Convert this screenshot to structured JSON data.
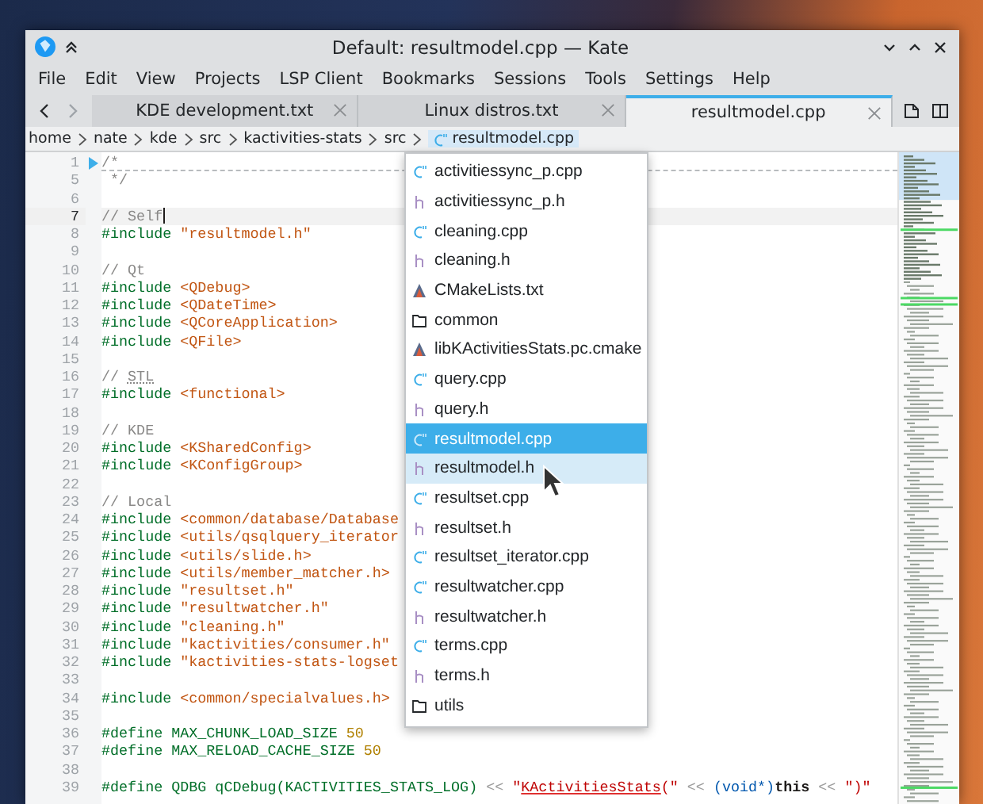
{
  "window": {
    "title": "Default: resultmodel.cpp — Kate"
  },
  "menu": [
    "File",
    "Edit",
    "View",
    "Projects",
    "LSP Client",
    "Bookmarks",
    "Sessions",
    "Tools",
    "Settings",
    "Help"
  ],
  "tabs": [
    {
      "label": "KDE development.txt",
      "selected": false
    },
    {
      "label": "Linux distros.txt",
      "selected": false
    },
    {
      "label": "resultmodel.cpp",
      "selected": true
    }
  ],
  "breadcrumb": {
    "path": [
      "home",
      "nate",
      "kde",
      "src",
      "kactivities-stats",
      "src"
    ],
    "file": "resultmodel.cpp"
  },
  "editor": {
    "lines": [
      {
        "number": "1",
        "current": false,
        "folded": true,
        "code": [
          {
            "kind": "comment",
            "text": "/*"
          }
        ]
      },
      {
        "number": "5",
        "current": false,
        "folded": false,
        "code": [
          {
            "kind": "comment",
            "text": " */"
          }
        ]
      },
      {
        "number": "6",
        "current": false,
        "folded": false
      },
      {
        "number": "7",
        "current": true,
        "folded": false,
        "code": [
          {
            "kind": "comment",
            "text": "// Self"
          }
        ]
      },
      {
        "number": "8",
        "current": false,
        "folded": false,
        "code": [
          {
            "kind": "directive",
            "text": "#include "
          },
          {
            "kind": "header",
            "text": "\"resultmodel.h\""
          }
        ]
      },
      {
        "number": "9",
        "current": false,
        "folded": false
      },
      {
        "number": "10",
        "current": false,
        "folded": false,
        "code": [
          {
            "kind": "comment",
            "text": "// Qt"
          }
        ]
      },
      {
        "number": "11",
        "current": false,
        "folded": false,
        "code": [
          {
            "kind": "directive",
            "text": "#include "
          },
          {
            "kind": "header",
            "text": "<QDebug>"
          }
        ]
      },
      {
        "number": "12",
        "current": false,
        "folded": false,
        "code": [
          {
            "kind": "directive",
            "text": "#include "
          },
          {
            "kind": "header",
            "text": "<QDateTime>"
          }
        ]
      },
      {
        "number": "13",
        "current": false,
        "folded": false,
        "code": [
          {
            "kind": "directive",
            "text": "#include "
          },
          {
            "kind": "header",
            "text": "<QCoreApplication>"
          }
        ]
      },
      {
        "number": "14",
        "current": false,
        "folded": false,
        "code": [
          {
            "kind": "directive",
            "text": "#include "
          },
          {
            "kind": "header",
            "text": "<QFile>"
          }
        ]
      },
      {
        "number": "15",
        "current": false,
        "folded": false
      },
      {
        "number": "16",
        "current": false,
        "folded": false,
        "code": [
          {
            "kind": "comment",
            "text": "// "
          },
          {
            "kind": "flagged_comment",
            "text": "STL"
          }
        ]
      },
      {
        "number": "17",
        "current": false,
        "folded": false,
        "code": [
          {
            "kind": "directive",
            "text": "#include "
          },
          {
            "kind": "header",
            "text": "<functional>"
          }
        ]
      },
      {
        "number": "18",
        "current": false,
        "folded": false
      },
      {
        "number": "19",
        "current": false,
        "folded": false,
        "code": [
          {
            "kind": "comment",
            "text": "// KDE"
          }
        ]
      },
      {
        "number": "20",
        "current": false,
        "folded": false,
        "code": [
          {
            "kind": "directive",
            "text": "#include "
          },
          {
            "kind": "header",
            "text": "<KSharedConfig>"
          }
        ]
      },
      {
        "number": "21",
        "current": false,
        "folded": false,
        "code": [
          {
            "kind": "directive",
            "text": "#include "
          },
          {
            "kind": "header",
            "text": "<KConfigGroup>"
          }
        ]
      },
      {
        "number": "22",
        "current": false,
        "folded": false
      },
      {
        "number": "23",
        "current": false,
        "folded": false,
        "code": [
          {
            "kind": "comment",
            "text": "// Local"
          }
        ]
      },
      {
        "number": "24",
        "current": false,
        "folded": false,
        "code": [
          {
            "kind": "directive",
            "text": "#include "
          },
          {
            "kind": "header",
            "text": "<common/database/Database"
          }
        ]
      },
      {
        "number": "25",
        "current": false,
        "folded": false,
        "code": [
          {
            "kind": "directive",
            "text": "#include "
          },
          {
            "kind": "header",
            "text": "<utils/qsqlquery_iterator"
          }
        ]
      },
      {
        "number": "26",
        "current": false,
        "folded": false,
        "code": [
          {
            "kind": "directive",
            "text": "#include "
          },
          {
            "kind": "header",
            "text": "<utils/slide.h>"
          }
        ]
      },
      {
        "number": "27",
        "current": false,
        "folded": false,
        "code": [
          {
            "kind": "directive",
            "text": "#include "
          },
          {
            "kind": "header",
            "text": "<utils/member_matcher.h>"
          }
        ]
      },
      {
        "number": "28",
        "current": false,
        "folded": false,
        "code": [
          {
            "kind": "directive",
            "text": "#include "
          },
          {
            "kind": "header",
            "text": "\"resultset.h\""
          }
        ]
      },
      {
        "number": "29",
        "current": false,
        "folded": false,
        "code": [
          {
            "kind": "directive",
            "text": "#include "
          },
          {
            "kind": "header",
            "text": "\"resultwatcher.h\""
          }
        ]
      },
      {
        "number": "30",
        "current": false,
        "folded": false,
        "code": [
          {
            "kind": "directive",
            "text": "#include "
          },
          {
            "kind": "header",
            "text": "\"cleaning.h\""
          }
        ]
      },
      {
        "number": "31",
        "current": false,
        "folded": false,
        "code": [
          {
            "kind": "directive",
            "text": "#include "
          },
          {
            "kind": "header",
            "text": "\"kactivities/consumer.h\""
          }
        ]
      },
      {
        "number": "32",
        "current": false,
        "folded": false,
        "code": [
          {
            "kind": "directive",
            "text": "#include "
          },
          {
            "kind": "header",
            "text": "\"kactivities-stats-logset"
          }
        ]
      },
      {
        "number": "33",
        "current": false,
        "folded": false
      },
      {
        "number": "34",
        "current": false,
        "folded": false,
        "code": [
          {
            "kind": "directive",
            "text": "#include "
          },
          {
            "kind": "header",
            "text": "<common/specialvalues.h>"
          }
        ]
      },
      {
        "number": "35",
        "current": false,
        "folded": false
      },
      {
        "number": "36",
        "current": false,
        "folded": false,
        "code": [
          {
            "kind": "directive",
            "text": "#define MAX_CHUNK_LOAD_SIZE "
          },
          {
            "kind": "number",
            "text": "50"
          }
        ]
      },
      {
        "number": "37",
        "current": false,
        "folded": false,
        "code": [
          {
            "kind": "directive",
            "text": "#define MAX_RELOAD_CACHE_SIZE "
          },
          {
            "kind": "number",
            "text": "50"
          }
        ]
      },
      {
        "number": "38",
        "current": false,
        "folded": false
      },
      {
        "number": "39",
        "current": false,
        "folded": false,
        "code": [
          {
            "kind": "directive",
            "text": "#define QDBG qCDebug(KACTIVITIES_STATS_LOG) "
          },
          {
            "kind": "operator",
            "text": "<< "
          },
          {
            "kind": "string",
            "text": "\""
          },
          {
            "kind": "flagged_string",
            "text": "KActivitiesStats"
          },
          {
            "kind": "string",
            "text": "(\""
          },
          {
            "kind": "operator",
            "text": " << "
          },
          {
            "kind": "cast",
            "text": "(void*)"
          },
          {
            "kind": "keyword",
            "text": "this"
          },
          {
            "kind": "operator",
            "text": " << "
          },
          {
            "kind": "string",
            "text": "\")\""
          }
        ]
      }
    ]
  },
  "file_popup": {
    "items": [
      {
        "label": "activitiessync_p.cpp",
        "kind": "cpp",
        "selected": false,
        "hovered": false
      },
      {
        "label": "activitiessync_p.h",
        "kind": "h",
        "selected": false,
        "hovered": false
      },
      {
        "label": "cleaning.cpp",
        "kind": "cpp",
        "selected": false,
        "hovered": false
      },
      {
        "label": "cleaning.h",
        "kind": "h",
        "selected": false,
        "hovered": false
      },
      {
        "label": "CMakeLists.txt",
        "kind": "cmake",
        "selected": false,
        "hovered": false
      },
      {
        "label": "common",
        "kind": "folder",
        "selected": false,
        "hovered": false
      },
      {
        "label": "libKActivitiesStats.pc.cmake",
        "kind": "cmake",
        "selected": false,
        "hovered": false
      },
      {
        "label": "query.cpp",
        "kind": "cpp",
        "selected": false,
        "hovered": false
      },
      {
        "label": "query.h",
        "kind": "h",
        "selected": false,
        "hovered": false
      },
      {
        "label": "resultmodel.cpp",
        "kind": "cpp",
        "selected": true,
        "hovered": false
      },
      {
        "label": "resultmodel.h",
        "kind": "h",
        "selected": false,
        "hovered": true
      },
      {
        "label": "resultset.cpp",
        "kind": "cpp",
        "selected": false,
        "hovered": false
      },
      {
        "label": "resultset.h",
        "kind": "h",
        "selected": false,
        "hovered": false
      },
      {
        "label": "resultset_iterator.cpp",
        "kind": "cpp",
        "selected": false,
        "hovered": false
      },
      {
        "label": "resultwatcher.cpp",
        "kind": "cpp",
        "selected": false,
        "hovered": false
      },
      {
        "label": "resultwatcher.h",
        "kind": "h",
        "selected": false,
        "hovered": false
      },
      {
        "label": "terms.cpp",
        "kind": "cpp",
        "selected": false,
        "hovered": false
      },
      {
        "label": "terms.h",
        "kind": "h",
        "selected": false,
        "hovered": false
      },
      {
        "label": "utils",
        "kind": "folder",
        "selected": false,
        "hovered": false
      }
    ]
  }
}
